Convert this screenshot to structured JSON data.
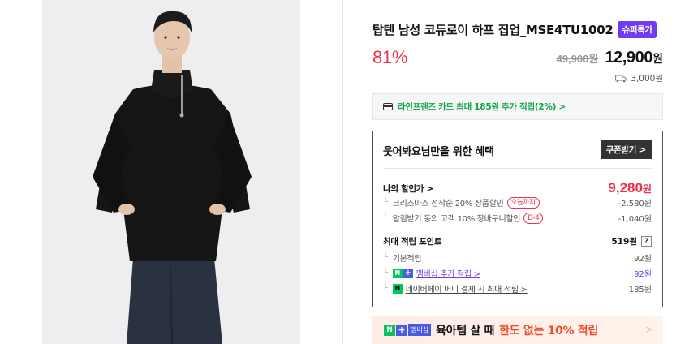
{
  "product": {
    "title": "탑텐 남성 코듀로이 하프 집업_MSE4TU1002",
    "badge": "슈퍼특가",
    "discount_rate": "81%",
    "original_price": "49,900원",
    "sale_price": "12,900",
    "sale_unit": "원",
    "shipping_fee": "3,000원"
  },
  "card_banner": {
    "text": "라인프렌즈 카드 최대 185원 추가 적립(2%) >"
  },
  "benefits": {
    "heading": "웃어봐요님만을 위한 혜택",
    "coupon_button": "쿠폰받기 >",
    "my_discount": {
      "label": "나의 할인가 >",
      "value": "9,280",
      "unit": "원"
    },
    "discount_items": [
      {
        "label": "크리스마스 선착순 20% 상품할인",
        "pill": "오늘까지",
        "value": "-2,580원"
      },
      {
        "label": "알림받기 동의 고객 10% 장바구니할인",
        "pill": "D-4",
        "value": "-1,040원"
      }
    ],
    "points": {
      "label": "최대 적립 포인트",
      "value": "519원",
      "help": "?"
    },
    "point_items": [
      {
        "label": "기본적립",
        "value": "92원"
      },
      {
        "label": "멤버십 추가 적립 >",
        "value": "92원"
      },
      {
        "label": "네이버페이 머니 결제 시 최대 적립 >",
        "value": "185원"
      }
    ]
  },
  "promo": {
    "badge_n": "N",
    "badge_plus": "+",
    "badge_member": "멤버십",
    "text_main": "육아템 살 때",
    "text_highlight": "한도 없는 10% 적립",
    "chevron": ">"
  },
  "colors": {
    "accent_red": "#e8344d",
    "super_purple": "#6f3cf0",
    "naver_green": "#03c75a",
    "plus_blue": "#4a5ce6",
    "card_green": "#14a547"
  }
}
